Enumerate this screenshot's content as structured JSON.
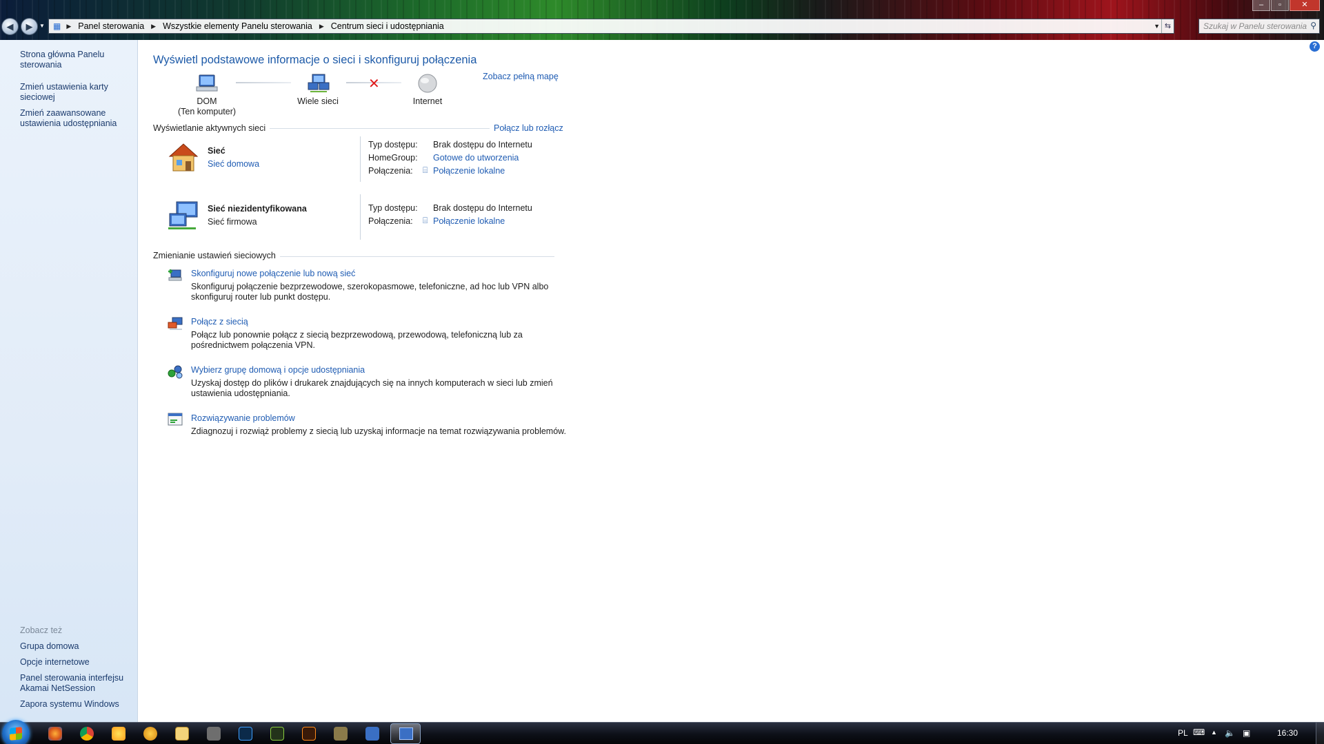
{
  "breadcrumb": [
    "Panel sterowania",
    "Wszystkie elementy Panelu sterowania",
    "Centrum sieci i udostępniania"
  ],
  "search": {
    "placeholder": "Szukaj w Panelu sterowania"
  },
  "sidebar": {
    "links": [
      "Strona główna Panelu sterowania",
      "Zmień ustawienia karty sieciowej",
      "Zmień zaawansowane ustawienia udostępniania"
    ],
    "see_also_title": "Zobacz też",
    "see_also": [
      "Grupa domowa",
      "Opcje internetowe",
      "Panel sterowania interfejsu Akamai NetSession",
      "Zapora systemu Windows"
    ]
  },
  "main": {
    "title": "Wyświetl podstawowe informacje o sieci i skonfiguruj połączenia",
    "full_map_link": "Zobacz pełną mapę",
    "map": {
      "computer_name": "DOM",
      "computer_sub": "(Ten komputer)",
      "middle": "Wiele sieci",
      "internet": "Internet"
    },
    "active_title": "Wyświetlanie aktywnych sieci",
    "connect_link": "Połącz lub rozłącz",
    "networks": [
      {
        "name": "Sieć",
        "type": "Sieć domowa",
        "type_is_link": true,
        "access_label": "Typ dostępu:",
        "access_value": "Brak dostępu do Internetu",
        "homegroup_label": "HomeGroup:",
        "homegroup_value": "Gotowe do utworzenia",
        "conn_label": "Połączenia:",
        "conn_value": "Połączenie lokalne"
      },
      {
        "name": "Sieć niezidentyfikowana",
        "type": "Sieć firmowa",
        "type_is_link": false,
        "access_label": "Typ dostępu:",
        "access_value": "Brak dostępu do Internetu",
        "conn_label": "Połączenia:",
        "conn_value": "Połączenie lokalne"
      }
    ],
    "change_title": "Zmienianie ustawień sieciowych",
    "tasks": [
      {
        "title": "Skonfiguruj nowe połączenie lub nową sieć",
        "desc": "Skonfiguruj połączenie bezprzewodowe, szerokopasmowe, telefoniczne, ad hoc lub VPN albo skonfiguruj router lub punkt dostępu."
      },
      {
        "title": "Połącz z siecią",
        "desc": "Połącz lub ponownie połącz z siecią bezprzewodową, przewodową, telefoniczną lub za pośrednictwem połączenia VPN."
      },
      {
        "title": "Wybierz grupę domową i opcje udostępniania",
        "desc": "Uzyskaj dostęp do plików i drukarek znajdujących się na innych komputerach w sieci lub zmień ustawienia udostępniania."
      },
      {
        "title": "Rozwiązywanie problemów",
        "desc": "Zdiagnozuj i rozwiąż problemy z siecią lub uzyskaj informacje na temat rozwiązywania problemów."
      }
    ]
  },
  "taskbar": {
    "lang": "PL",
    "time": "16:30"
  },
  "colors": {
    "link": "#1f5cb3",
    "title": "#1d5aa8",
    "sidebar": "#e2ecf8"
  }
}
